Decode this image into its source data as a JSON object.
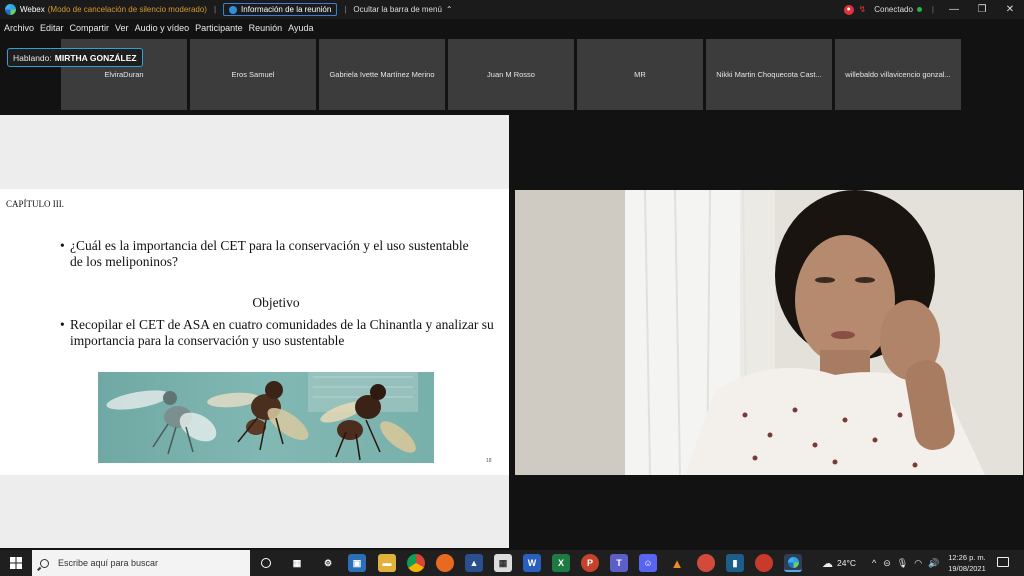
{
  "window": {
    "app_name": "Webex",
    "mode_text": "(Modo de cancelación de silencio moderado)",
    "meeting_info": "Información de la reunión",
    "hide_menu": "Ocultar la barra de menú",
    "status": "Conectado",
    "colors": {
      "accent": "#2fa1d7",
      "mode": "#d59a2b",
      "recording": "#e0323a",
      "connected": "#29b44a"
    }
  },
  "menu": [
    "Archivo",
    "Editar",
    "Compartir",
    "Ver",
    "Audio y vídeo",
    "Participante",
    "Reunión",
    "Ayuda"
  ],
  "speaking": {
    "label": "Hablando:",
    "name": "MIRTHA GONZÁLEZ"
  },
  "participants": [
    "ElviraDuran",
    "Eros Samuel",
    "Gabriela Ivette Martínez Merino",
    "Juan M Rosso",
    "MR",
    "Nikki Martin Choquecota Cast...",
    "willebaldo villavicencio gonzal..."
  ],
  "slide": {
    "chapter": "CAPÍTULO III.",
    "question": "¿Cuál es la importancia del CET para la conservación y el uso sustentable de los meliponinos?",
    "objective_title": "Objetivo",
    "objective": "Recopilar el CET de ASA en cuatro comunidades de la Chinantla y analizar su importancia para la conservación y uso sustentable",
    "page_number": "18"
  },
  "taskbar": {
    "search_placeholder": "Escribe aquí para buscar",
    "temperature": "24°C",
    "time": "12:26 p. m.",
    "date": "19/08/2021"
  }
}
